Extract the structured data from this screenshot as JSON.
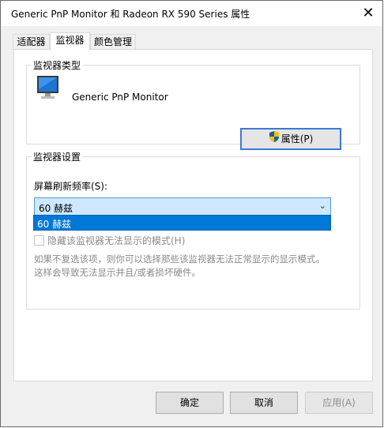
{
  "window": {
    "title": "Generic PnP Monitor 和 Radeon RX 590 Series 属性",
    "close_icon": "close-icon"
  },
  "tabs": [
    {
      "label": "适配器",
      "active": false
    },
    {
      "label": "监视器",
      "active": true
    },
    {
      "label": "颜色管理",
      "active": false
    }
  ],
  "monitor_type": {
    "group_title": "监视器类型",
    "icon": "monitor-icon",
    "name": "Generic PnP Monitor",
    "properties_button": "属性(P)",
    "properties_icon": "shield-icon"
  },
  "monitor_settings": {
    "group_title": "监视器设置",
    "refresh_label": "屏幕刷新频率(S):",
    "refresh_selected": "60 赫兹",
    "dropdown_options": [
      "60 赫兹"
    ],
    "hide_modes_label": "隐藏该监视器无法显示的模式(H)",
    "hide_modes_checked": false,
    "description_line1": "如果不复选该项，则你可以选择那些该监视器无法正常显示的显示模式。",
    "description_line2": "这样会导致无法显示并且/或者损坏硬件。"
  },
  "buttons": {
    "ok": "确定",
    "cancel": "取消",
    "apply": "应用(A)"
  },
  "colors": {
    "accent": "#0078d7",
    "select_bg": "#cde8ff"
  }
}
